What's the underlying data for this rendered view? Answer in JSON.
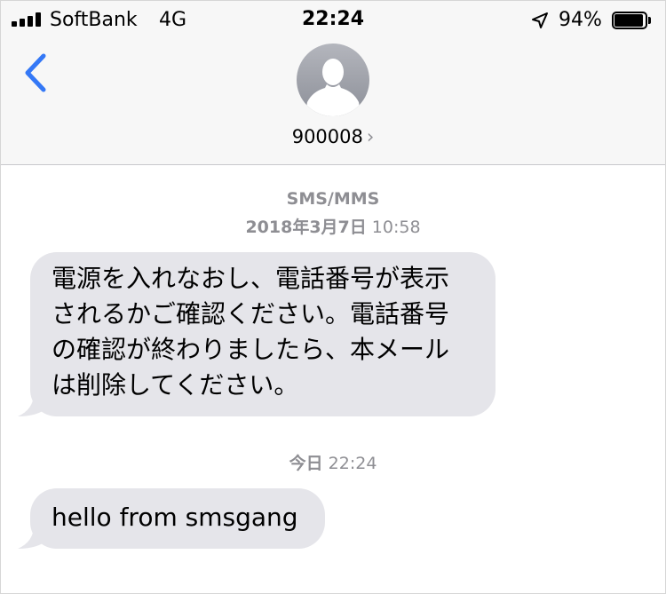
{
  "status_bar": {
    "carrier": "SoftBank",
    "network": "4G",
    "time": "22:24",
    "battery_percent": "94%",
    "battery_level": 0.94,
    "signal_icon": "signal-bars-icon",
    "location_icon": "location-arrow-icon"
  },
  "header": {
    "back_icon": "chevron-left-icon",
    "avatar_icon": "person-silhouette-icon",
    "contact_name": "900008",
    "contact_chevron": "›"
  },
  "thread": {
    "service_label": "SMS/MMS",
    "first_date_bold": "2018年3月7日",
    "first_time": " 10:58",
    "messages": [
      {
        "direction": "incoming",
        "lines": [
          "電源を入れなおし、電話番号が表示",
          "されるかご確認ください。電話番号",
          "の確認が終わりましたら、本メール",
          "は削除してください。"
        ]
      },
      {
        "direction": "incoming",
        "text": "hello from smsgang"
      }
    ],
    "second_date_bold": "今日",
    "second_time": " 22:24"
  },
  "colors": {
    "bubble_incoming": "#e5e5ea",
    "accent": "#3478f6",
    "timestamp": "#8e8e93",
    "header_bg": "#f7f7f7"
  }
}
